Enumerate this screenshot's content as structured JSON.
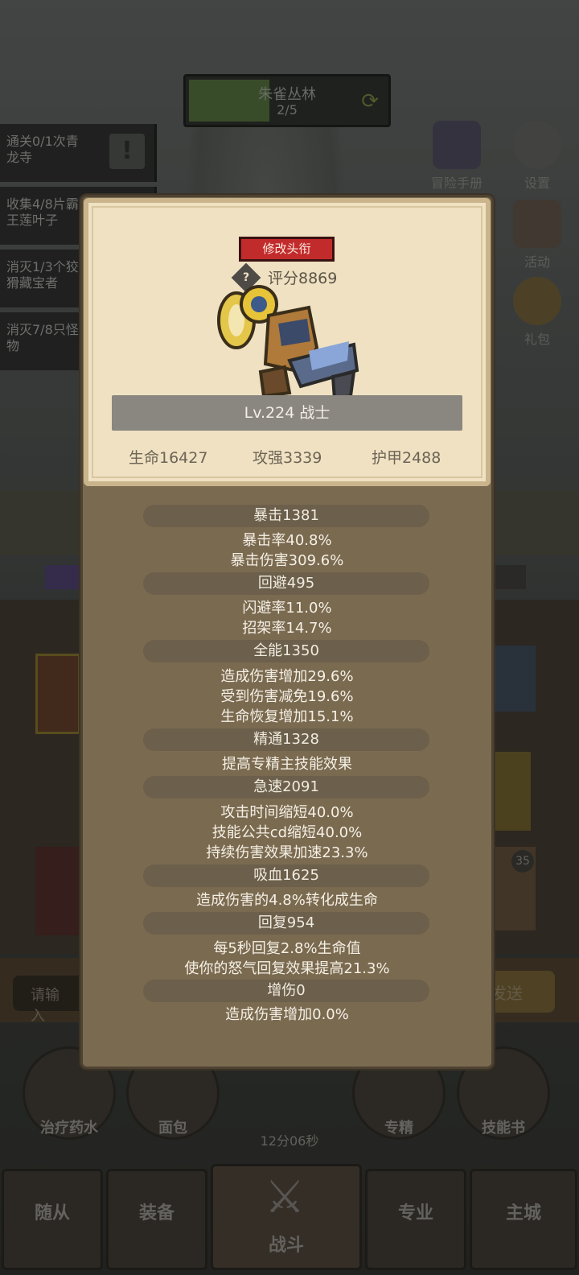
{
  "stage": {
    "name": "朱雀丛林",
    "progress": "2/5"
  },
  "quests": [
    {
      "line1": "通关0/1次青",
      "line2": "龙寺"
    },
    {
      "line1": "收集4/8片霸",
      "line2": "王莲叶子"
    },
    {
      "line1": "消灭1/3个狡",
      "line2": "猾藏宝者"
    },
    {
      "line1": "消灭7/8只怪",
      "line2": "物"
    }
  ],
  "side": {
    "adventure_book": "冒险手册",
    "settings": "设置",
    "events": "活动",
    "gift": "礼包"
  },
  "popup": {
    "rename_label": "修改头衔",
    "help_symbol": "?",
    "score": "评分8869",
    "level_class": "Lv.224 战士",
    "main_stats": {
      "hp": "生命16427",
      "attack": "攻强3339",
      "armor": "护甲2488"
    },
    "stats": [
      {
        "head": "暴击1381",
        "lines": [
          "暴击率40.8%",
          "暴击伤害309.6%"
        ]
      },
      {
        "head": "回避495",
        "lines": [
          "闪避率11.0%",
          "招架率14.7%"
        ]
      },
      {
        "head": "全能1350",
        "lines": [
          "造成伤害增加29.6%",
          "受到伤害减免19.6%",
          "生命恢复增加15.1%"
        ]
      },
      {
        "head": "精通1328",
        "lines": [
          "提高专精主技能效果"
        ]
      },
      {
        "head": "急速2091",
        "lines": [
          "攻击时间缩短40.0%",
          "技能公共cd缩短40.0%",
          "持续伤害效果加速23.3%"
        ]
      },
      {
        "head": "吸血1625",
        "lines": [
          "造成伤害的4.8%转化成生命"
        ]
      },
      {
        "head": "回复954",
        "lines": [
          "每5秒回复2.8%生命值",
          "使你的怒气回复效果提高21.3%"
        ]
      },
      {
        "head": "增伤0",
        "lines": [
          "造成伤害增加0.0%"
        ]
      }
    ]
  },
  "chat": {
    "input_placeholder": "请输入",
    "send_label": "发送"
  },
  "quick_items": {
    "potion": "治疗药水",
    "bread": "面包",
    "spec": "专精",
    "skill_book": "技能书"
  },
  "timer": "12分06秒",
  "badge_count": "35",
  "tabs": {
    "followers": "随从",
    "equipment": "装备",
    "battle": "战斗",
    "profession": "专业",
    "city": "主城"
  }
}
